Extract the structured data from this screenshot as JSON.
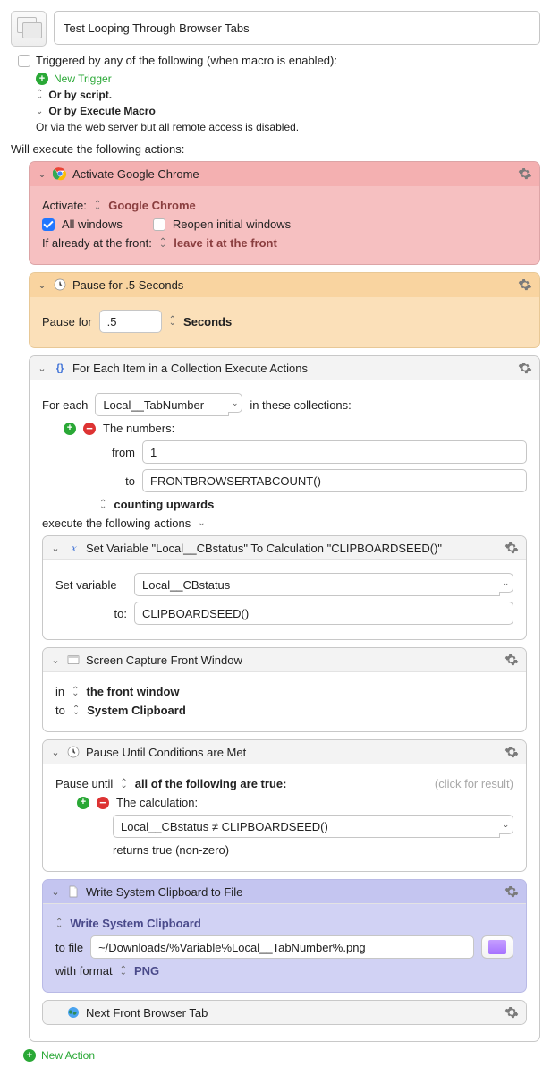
{
  "header": {
    "title": "Test Looping Through Browser Tabs"
  },
  "trigger": {
    "label": "Triggered by any of the following (when macro is enabled):",
    "new_trigger": "New Trigger",
    "or_script": "Or by script.",
    "or_execute": "Or by Execute Macro",
    "web_server": "Or via the web server but all remote access is disabled."
  },
  "actions_header": "Will execute the following actions:",
  "act1": {
    "title": "Activate Google Chrome",
    "activate_label": "Activate:",
    "app": "Google Chrome",
    "all_windows": "All windows",
    "reopen": "Reopen initial windows",
    "front_label": "If already at the front:",
    "front_value": "leave it at the front"
  },
  "act2": {
    "title": "Pause for .5 Seconds",
    "label": "Pause for",
    "value": ".5",
    "unit": "Seconds"
  },
  "act3": {
    "title": "For Each Item in a Collection Execute Actions",
    "foreach_label": "For each",
    "var": "Local__TabNumber",
    "collections": "in these collections:",
    "numbers_label": "The numbers:",
    "from_label": "from",
    "from_value": "1",
    "to_label": "to",
    "to_value": "FRONTBROWSERTABCOUNT()",
    "counting": "counting upwards",
    "exec_label": "execute the following actions"
  },
  "act3a": {
    "title": "Set Variable \"Local__CBstatus\" To Calculation \"CLIPBOARDSEED()\"",
    "set_label": "Set variable",
    "var": "Local__CBstatus",
    "to_label": "to:",
    "to_value": "CLIPBOARDSEED()"
  },
  "act3b": {
    "title": "Screen Capture Front Window",
    "in_label": "in",
    "in_value": "the front window",
    "to_label": "to",
    "to_value": "System Clipboard"
  },
  "act3c": {
    "title": "Pause Until Conditions are Met",
    "until_label": "Pause until",
    "until_value": "all of the following are true:",
    "click_hint": "(click for result)",
    "calc_label": "The calculation:",
    "calc_value": "Local__CBstatus ≠ CLIPBOARDSEED()",
    "returns": "returns true (non-zero)"
  },
  "act3d": {
    "title": "Write System Clipboard to File",
    "write": "Write System Clipboard",
    "tofile_label": "to file",
    "tofile_value": "~/Downloads/%Variable%Local__TabNumber%.png",
    "format_label": "with format",
    "format_value": "PNG"
  },
  "act3e": {
    "title": "Next Front Browser Tab"
  },
  "new_action": "New Action"
}
